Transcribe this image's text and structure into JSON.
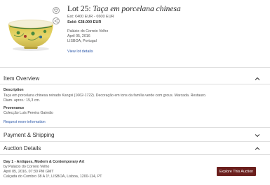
{
  "lot": {
    "number_label": "Lot 25:",
    "name": "Taça em porcelana chinesa",
    "estimate": "Est: €400 EUR - €600 EUR",
    "sold": "Sold: €28.000 EUR",
    "venue_lines": [
      "Palácio do Correio Velho",
      "April 05, 2016",
      "LISBOA, Portugal"
    ],
    "view_details": "View lot details",
    "icons": {
      "favorite": "heart-icon",
      "share": "share-icon"
    }
  },
  "item_overview": {
    "header": "Item Overview",
    "description_label": "Description",
    "description_lines": [
      "Taça em porcelana chinesa reinado Kangxi (1662-1722). Decoração em tons da família verde com grous. Marcada. Restauro.",
      "Diam. aprox.: 15,3 cm."
    ],
    "provenance_label": "Provenance",
    "provenance_text": "Colecção Luís Pereira Gairnão",
    "request_more": "Request more information"
  },
  "payment_shipping": {
    "header": "Payment & Shipping"
  },
  "auction_details": {
    "header": "Auction Details",
    "title": "Day 1 - Antiques, Modern & Contemporary Art",
    "lines": [
      "by Palácio do Correio Velho",
      "April 05, 2016, 07:30 PM GMT",
      "Calçada do Combro 38 A 1º, LISBOA, Lisboa, 1200-114, PT"
    ],
    "explore_button": "Explore This Auction"
  },
  "colors": {
    "link": "#2a56a8",
    "button_bg": "#6b1f1d",
    "rule": "#dddddd"
  }
}
